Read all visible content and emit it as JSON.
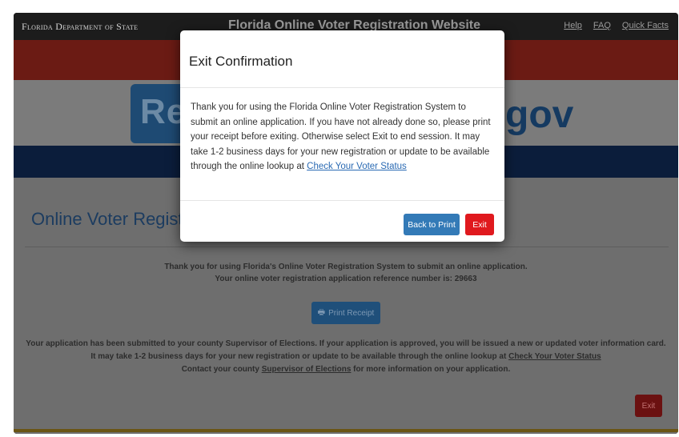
{
  "header": {
    "brand": "Florida Department of State",
    "title": "Florida Online Voter Registration Website",
    "links": [
      "Help",
      "FAQ",
      "Quick Facts"
    ]
  },
  "banner": {
    "logo_left": "Re",
    "logo_right": "gov"
  },
  "page": {
    "title": "Online Voter Regist",
    "thank_you": "Thank you for using Florida's Online Voter Registration System to submit an online application.",
    "reference": "Your online voter registration application reference number is: 29663",
    "print_button": "Print Receipt",
    "submitted": "Your application has been submitted to your county Supervisor of Elections. If your application is approved, you will be issued a new or updated voter information card.",
    "delay_prefix": "It may take 1-2 business days for your new registration or update to be available through the online lookup at ",
    "delay_link": "Check Your Voter Status",
    "contact_prefix": "Contact your county ",
    "contact_link": "Supervisor of Elections",
    "contact_suffix": " for more information on your application.",
    "exit_button": "Exit"
  },
  "modal": {
    "title": "Exit Confirmation",
    "body_text": "Thank you for using the Florida Online Voter Registration System to submit an online application. If you have not already done so, please print your receipt before exiting. Otherwise select Exit to end session. It may take 1-2 business days for your new registration or update to be available through the online lookup at ",
    "body_link": "Check Your Voter Status",
    "back_button": "Back to Print",
    "exit_button": "Exit"
  },
  "colors": {
    "primary": "#337ab7",
    "danger": "#e0191e",
    "link": "#2a6ab3"
  },
  "icons": {
    "print": "printer-icon"
  }
}
